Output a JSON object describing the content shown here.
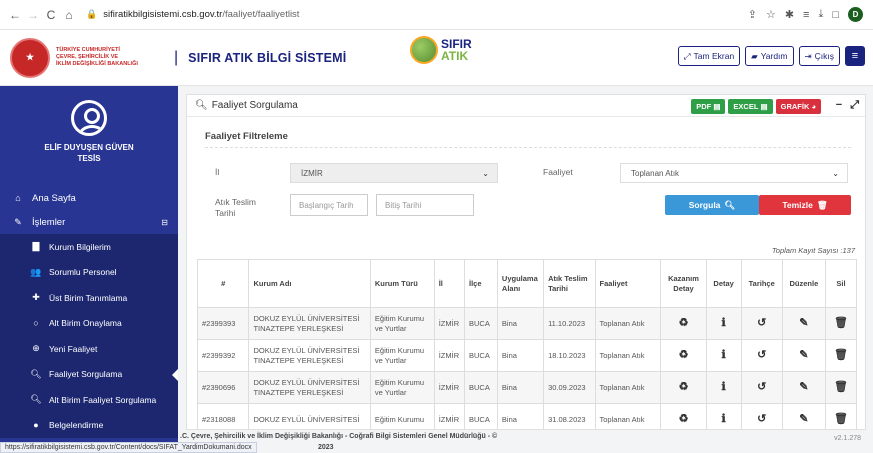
{
  "browser": {
    "url_host": "sifiratikbilgisistemi.csb.gov.tr",
    "url_path": "/faaliyet/faaliyetlist",
    "profile_initial": "D"
  },
  "header": {
    "ministry_line1": "TÜRKİYE CUMHURİYETİ",
    "ministry_line2": "ÇEVRE, ŞEHİRCİLİK VE",
    "ministry_line3": "İKLİM DEĞİŞİKLİĞİ BAKANLIĞI",
    "system_title": "SIFIR ATIK BİLGİ SİSTEMİ",
    "logo_line1": "SIFIR",
    "logo_line2": "ATIK",
    "fullscreen_label": "Tam Ekran",
    "help_label": "Yardım",
    "logout_label": "Çıkış"
  },
  "sidebar": {
    "user_name": "ELİF DUYUŞEN GÜVEN",
    "user_role": "TESİS",
    "home_label": "Ana Sayfa",
    "ops_label": "İşlemler",
    "items": [
      {
        "label": "Kurum Bilgilerim",
        "icon": "building-icon"
      },
      {
        "label": "Sorumlu Personel",
        "icon": "users-icon"
      },
      {
        "label": "Üst Birim Tanımlama",
        "icon": "plus-icon"
      },
      {
        "label": "Alt Birim Onaylama",
        "icon": "circle-icon"
      },
      {
        "label": "Yeni Faaliyet",
        "icon": "plus-circle-icon"
      },
      {
        "label": "Faaliyet Sorgulama",
        "icon": "search-icon"
      },
      {
        "label": "Alt Birim Faaliyet Sorgulama",
        "icon": "search-icon"
      },
      {
        "label": "Belgelendirme",
        "icon": "badge-icon"
      }
    ]
  },
  "card": {
    "title": "Faaliyet Sorgulama",
    "pdf_label": "PDF",
    "excel_label": "EXCEL",
    "graph_label": "GRAFİK",
    "filter_title": "Faaliyet Filtreleme",
    "il_label": "İl",
    "il_value": "İZMİR",
    "faaliyet_label": "Faaliyet",
    "faaliyet_value": "Toplanan Atık",
    "date_label_1": "Atık Teslim",
    "date_label_2": "Tarihi",
    "start_placeholder": "Başlangıç Tarih",
    "end_placeholder": "Bitiş Tarihi",
    "query_label": "Sorgula",
    "clear_label": "Temizle",
    "total_label": "Toplam Kayıt Sayısı :137"
  },
  "table": {
    "headers": [
      "#",
      "Kurum Adı",
      "Kurum Türü",
      "İl",
      "İlçe",
      "Uygulama Alanı",
      "Atık Teslim Tarihi",
      "Faaliyet",
      "Kazanım Detay",
      "Detay",
      "Tarihçe",
      "Düzenle",
      "Sil"
    ],
    "rows": [
      {
        "id": "#2399393",
        "name1": "DOKUZ EYLÜL ÜNİVERSİTESİ",
        "name2": "TINAZTEPE YERLEŞKESİ",
        "type1": "Eğitim Kurumu",
        "type2": "ve Yurtlar",
        "il": "İZMİR",
        "ilce": "BUCA",
        "alan": "Bina",
        "date": "11.10.2023",
        "faaliyet": "Toplanan Atık"
      },
      {
        "id": "#2399392",
        "name1": "DOKUZ EYLÜL ÜNİVERSİTESİ",
        "name2": "TINAZTEPE YERLEŞKESİ",
        "type1": "Eğitim Kurumu",
        "type2": "ve Yurtlar",
        "il": "İZMİR",
        "ilce": "BUCA",
        "alan": "Bina",
        "date": "18.10.2023",
        "faaliyet": "Toplanan Atık"
      },
      {
        "id": "#2390696",
        "name1": "DOKUZ EYLÜL ÜNİVERSİTESİ",
        "name2": "TINAZTEPE YERLEŞKESİ",
        "type1": "Eğitim Kurumu",
        "type2": "ve Yurtlar",
        "il": "İZMİR",
        "ilce": "BUCA",
        "alan": "Bina",
        "date": "30.09.2023",
        "faaliyet": "Toplanan Atık"
      },
      {
        "id": "#2318088",
        "name1": "DOKUZ EYLÜL ÜNİVERSİTESİ",
        "name2": "",
        "type1": "Eğitim Kurumu",
        "type2": "",
        "il": "İZMİR",
        "ilce": "BUCA",
        "alan": "Bina",
        "date": "31.08.2023",
        "faaliyet": "Toplanan Atık"
      }
    ]
  },
  "footer": {
    "text": ".C. Çevre, Şehircilik ve İklim Değişikliği Bakanlığı - Coğrafi Bilgi Sistemleri Genel Müdürlüğü - ©",
    "year": "2023",
    "version": "v2.1.278"
  },
  "statusbar": {
    "link": "https://sifiratikbilgisistemi.csb.gov.tr/Content/docs/SIFAT_YardimDokumani.docx"
  }
}
